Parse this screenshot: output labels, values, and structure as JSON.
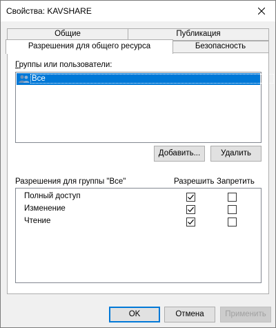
{
  "window": {
    "title": "Свойства: KAVSHARE"
  },
  "tabs": {
    "row1": [
      "Общие",
      "Публикация"
    ],
    "row2": [
      "Разрешения для общего ресурса",
      "Безопасность"
    ]
  },
  "groups": {
    "label": "Группы или пользователи:",
    "items": [
      {
        "name": "Все",
        "selected": true,
        "icon": "users-icon"
      }
    ]
  },
  "buttons": {
    "add": "Добавить...",
    "remove": "Удалить",
    "ok": "OK",
    "cancel": "Отмена",
    "apply": "Применить"
  },
  "permissions": {
    "label": "Разрешения для группы \"Все\"",
    "allow_header": "Разрешить",
    "deny_header": "Запретить",
    "rows": [
      {
        "name": "Полный доступ",
        "allow": true,
        "deny": false
      },
      {
        "name": "Изменение",
        "allow": true,
        "deny": false
      },
      {
        "name": "Чтение",
        "allow": true,
        "deny": false
      }
    ]
  },
  "colors": {
    "selection": "#0078d7",
    "default_button_border": "#0078d7"
  }
}
